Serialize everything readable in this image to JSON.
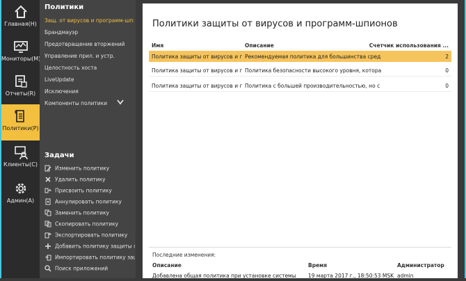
{
  "nav": {
    "items": [
      {
        "label": "Главная(H)",
        "icon": "home-icon"
      },
      {
        "label": "Мониторы(M)",
        "icon": "monitor-icon"
      },
      {
        "label": "Отчеты(R)",
        "icon": "reports-icon"
      },
      {
        "label": "Политики(P)",
        "icon": "policies-icon"
      },
      {
        "label": "Клиенты(C)",
        "icon": "clients-icon"
      },
      {
        "label": "Админ(A)",
        "icon": "admin-gear-icon"
      }
    ],
    "active": "Политики(P)",
    "active_color": "#f3bf3f"
  },
  "policies_panel": {
    "heading": "Политики",
    "items": [
      "Защ. от вирусов и программ-шпионов",
      "Брандмауэр",
      "Предотвращение вторжений",
      "Управление прил. и устр.",
      "Целостность хоста",
      "LiveUpdate",
      "Исключения",
      "Компоненты политики"
    ],
    "selected": "Защ. от вирусов и программ-шпионов"
  },
  "tasks_panel": {
    "heading": "Задачи",
    "items": [
      {
        "label": "Изменить политику",
        "icon": "edit-icon"
      },
      {
        "label": "Удалить политику",
        "icon": "delete-icon"
      },
      {
        "label": "Присвоить политику",
        "icon": "assign-icon"
      },
      {
        "label": "Аннулировать политику",
        "icon": "revoke-icon"
      },
      {
        "label": "Заменить политику",
        "icon": "replace-icon"
      },
      {
        "label": "Скопировать политику",
        "icon": "copy-icon"
      },
      {
        "label": "Экспортировать политику",
        "icon": "export-icon"
      },
      {
        "label": "Добавить политику защиты от в",
        "icon": "add-icon"
      },
      {
        "label": "Импортировать политику защит",
        "icon": "import-icon"
      },
      {
        "label": "Поиск приложений",
        "icon": "search-icon"
      }
    ]
  },
  "main": {
    "title": "Политики защиты от вирусов и программ-шпионов",
    "columns": [
      "Имя",
      "Описание",
      "Счетчик использования ..."
    ],
    "rows": [
      {
        "name": "Политика защиты от вирусов и п...",
        "desc": "Рекомендуемая политика для большинства сред, об...",
        "count": "2"
      },
      {
        "name": "Политика защиты от вирусов и п...",
        "desc": "Политика безопасности высокого уровня, которая м...",
        "count": "0"
      },
      {
        "name": "Политика защиты от вирусов и пр...",
        "desc": "Политика с большей производительностью, но с ме...",
        "count": "0"
      }
    ],
    "selected_row_color": "#f6c45c"
  },
  "changes": {
    "title": "Последние изменения:",
    "columns": [
      "Описание",
      "Время",
      "Администратор"
    ],
    "rows": [
      {
        "desc": "Добавлена общая политика при установке системы",
        "time": "19 марта 2017 г., 18:50:53 MSK",
        "admin": "admin"
      }
    ]
  }
}
